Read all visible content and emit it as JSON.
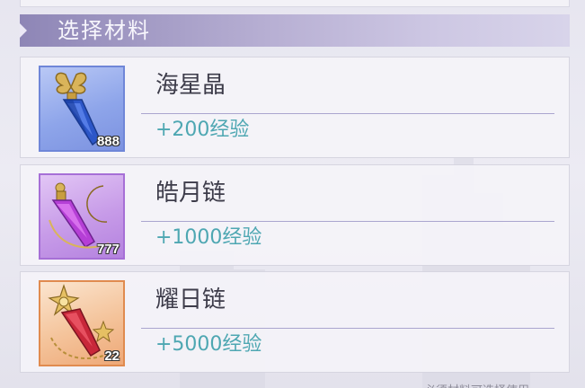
{
  "header": {
    "title": "选择材料"
  },
  "materials": [
    {
      "name": "海星晶",
      "exp": "+200经验",
      "count": "888",
      "icon": "blue-crystal-butterfly-icon",
      "accent": "#6f86d8"
    },
    {
      "name": "皓月链",
      "exp": "+1000经验",
      "count": "777",
      "icon": "purple-crystal-moon-icon",
      "accent": "#a66fd6"
    },
    {
      "name": "耀日链",
      "exp": "+5000经验",
      "count": "22",
      "icon": "red-crystal-sun-icon",
      "accent": "#e08b4f"
    }
  ],
  "colors": {
    "exp_text": "#4ea7b2",
    "header_gradient_start": "#8e86b6",
    "divider": "#aaa5cf"
  },
  "footer": {
    "hint_partial": "必须材料可选择使用"
  }
}
